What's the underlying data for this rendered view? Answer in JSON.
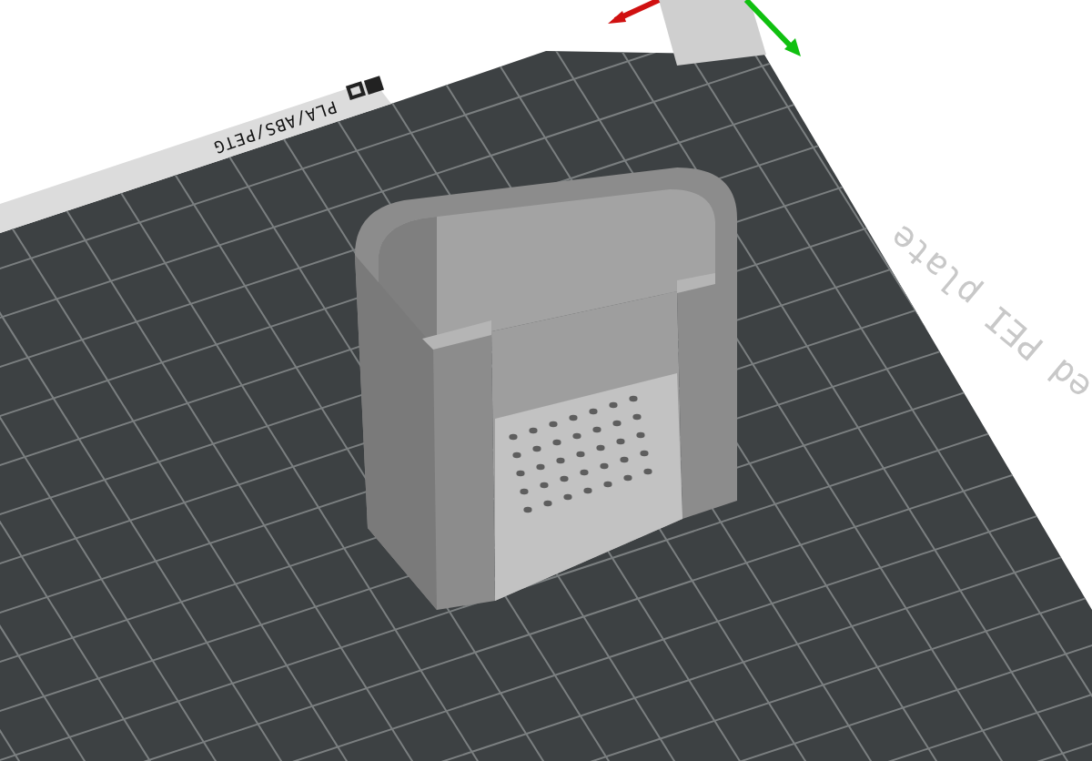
{
  "build_plate": {
    "filament_label": "PLA/ABS/PETG",
    "plate_name": "ed PEI plate"
  }
}
